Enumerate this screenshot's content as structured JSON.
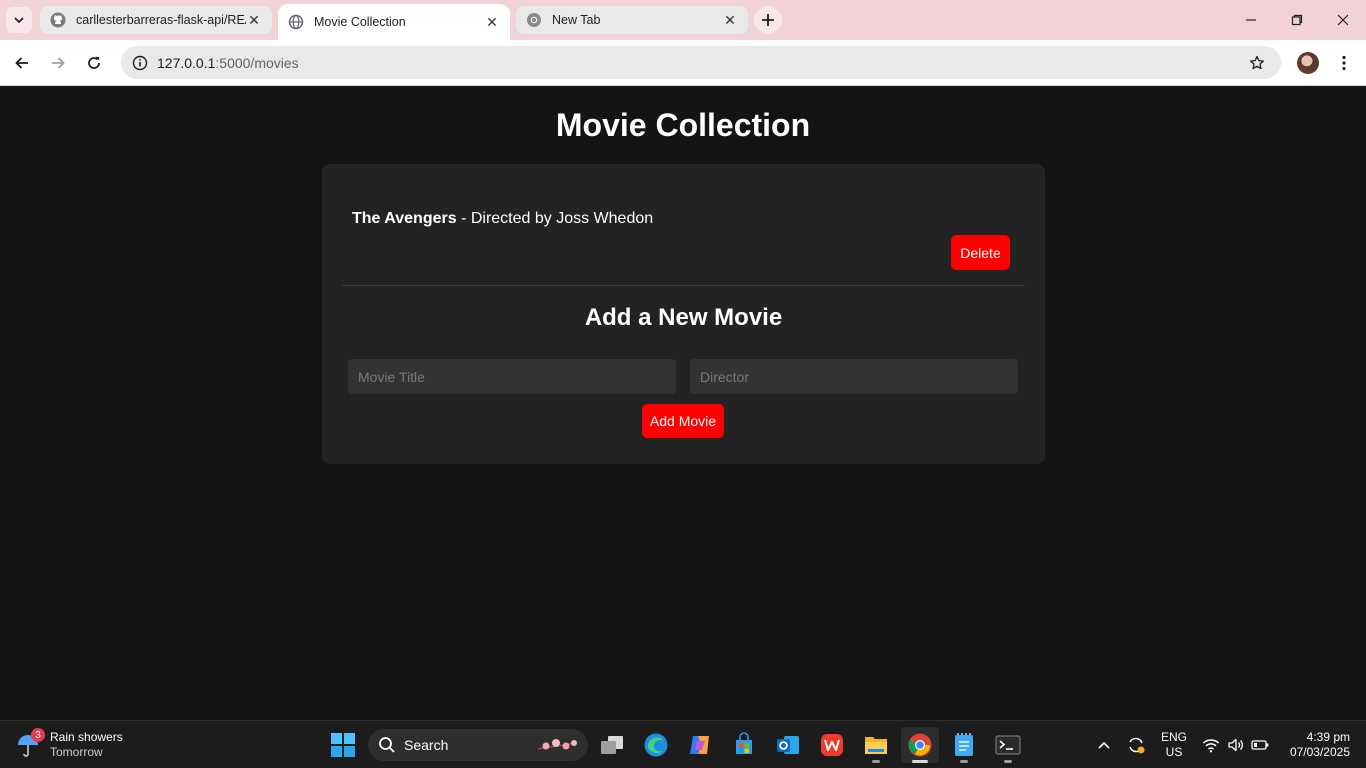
{
  "browser": {
    "tabs": [
      {
        "title": "carllesterbarreras-flask-api/READ",
        "favicon": "github-icon",
        "active": false
      },
      {
        "title": "Movie Collection",
        "favicon": "globe-icon",
        "active": true
      },
      {
        "title": "New Tab",
        "favicon": "chrome-icon",
        "active": false
      }
    ],
    "url_host": "127.0.0.1",
    "url_path": ":5000/movies"
  },
  "page": {
    "heading": "Movie Collection",
    "movies": [
      {
        "title": "The Avengers",
        "director_text": " - Directed by Joss Whedon",
        "delete_label": "Delete"
      }
    ],
    "form": {
      "heading": "Add a New Movie",
      "title_placeholder": "Movie Title",
      "director_placeholder": "Director",
      "submit_label": "Add Movie"
    }
  },
  "taskbar": {
    "weather_title": "Rain showers",
    "weather_subtitle": "Tomorrow",
    "weather_badge": "3",
    "search_label": "Search",
    "apps": [
      "task-view-icon",
      "edge-icon",
      "copilot-icon",
      "store-icon",
      "outlook-icon",
      "wps-icon",
      "file-explorer-icon",
      "chrome-icon",
      "notepad-icon",
      "terminal-icon"
    ],
    "lang_line1": "ENG",
    "lang_line2": "US",
    "time": "4:39 pm",
    "date": "07/03/2025"
  },
  "colors": {
    "accent_red": "#ff0000",
    "page_bg": "#141414",
    "card_bg": "#232323",
    "tabstrip_bg": "#f0d2d7"
  }
}
